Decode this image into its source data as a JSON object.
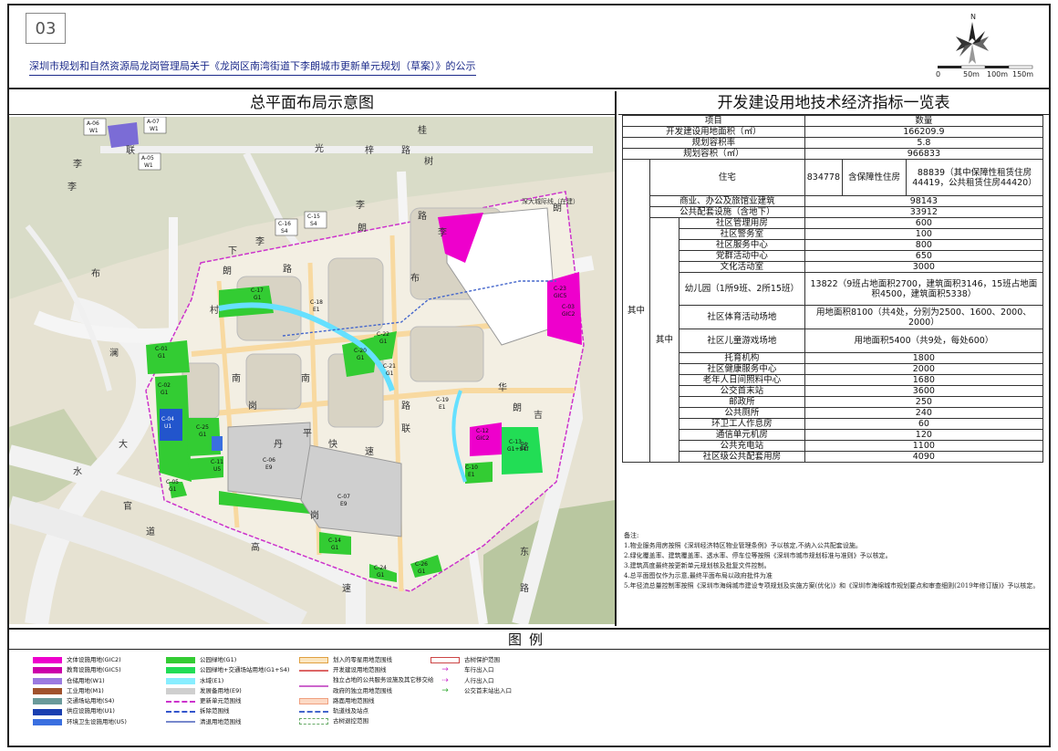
{
  "header": {
    "page_number": "03",
    "notice_title": "深圳市规划和自然资源局龙岗管理局关于《龙岗区南湾街道下李朗城市更新单元规划（草案）》的公示",
    "north_label": "N",
    "scale_labels": [
      "0",
      "50m",
      "100m",
      "150m"
    ]
  },
  "map_panel": {
    "title": "总平面布局示意图",
    "road_labels": [
      "桂",
      "光",
      "梓",
      "路",
      "树",
      "李",
      "朗",
      "深大城际线（在建）",
      "布",
      "澜",
      "大",
      "水",
      "官",
      "道",
      "高",
      "速",
      "南",
      "岗",
      "丹",
      "平",
      "快",
      "速",
      "路",
      "李",
      "朗",
      "路",
      "下",
      "李",
      "朗",
      "路",
      "李",
      "联",
      "李",
      "布",
      "村",
      "路",
      "联",
      "朗",
      "吉",
      "华",
      "南",
      "岗",
      "东",
      "路"
    ],
    "parcels": [
      {
        "code": "A-06",
        "use": "W1",
        "color": "#7b6cd6"
      },
      {
        "code": "A-07",
        "use": "W1",
        "color": "#7b6cd6"
      },
      {
        "code": "A-05",
        "use": "W1",
        "color": "#7b6cd6"
      },
      {
        "code": "C-16",
        "use": "S4",
        "color": "#cfcfcf"
      },
      {
        "code": "C-15",
        "use": "S4",
        "color": "#cfcfcf"
      },
      {
        "code": "C-17",
        "use": "G1",
        "color": "#33cc33"
      },
      {
        "code": "C-18",
        "use": "E1",
        "color": "#66e0ff"
      },
      {
        "code": "C-20",
        "use": "G1",
        "color": "#33cc33"
      },
      {
        "code": "C-22",
        "use": "G1",
        "color": "#33cc33"
      },
      {
        "code": "C-21",
        "use": "G1",
        "color": "#33cc33"
      },
      {
        "code": "C-01",
        "use": "G1",
        "color": "#33cc33"
      },
      {
        "code": "C-02",
        "use": "G1",
        "color": "#33cc33"
      },
      {
        "code": "C-04",
        "use": "U1",
        "color": "#2255cc"
      },
      {
        "code": "C-25",
        "use": "G1",
        "color": "#33cc33"
      },
      {
        "code": "C-11",
        "use": "U5",
        "color": "#2255cc"
      },
      {
        "code": "C-05",
        "use": "G1",
        "color": "#33cc33"
      },
      {
        "code": "C-06",
        "use": "E9",
        "color": "#cfcfcf"
      },
      {
        "code": "C-07",
        "use": "E9",
        "color": "#cfcfcf"
      },
      {
        "code": "C-14",
        "use": "G1",
        "color": "#33cc33"
      },
      {
        "code": "C-24",
        "use": "G1",
        "color": "#33cc33"
      },
      {
        "code": "C-26",
        "use": "G1",
        "color": "#33cc33"
      },
      {
        "code": "C-23",
        "use": "GIC5",
        "color": "#ee00cc"
      },
      {
        "code": "C-03",
        "use": "GIC2",
        "color": "#ee00cc"
      },
      {
        "code": "C-12",
        "use": "GIC2",
        "color": "#ee00cc"
      },
      {
        "code": "C-13",
        "use": "G1+S4",
        "color": "#33cc33"
      },
      {
        "code": "C-10",
        "use": "E1",
        "color": "#66e0ff"
      },
      {
        "code": "C-19",
        "use": "E1",
        "color": "#66e0ff"
      }
    ]
  },
  "indicator_table": {
    "title": "开发建设用地技术经济指标一览表",
    "head": {
      "item": "项目",
      "qty": "数量"
    },
    "rows_top": [
      {
        "item": "开发建设用地面积（㎡）",
        "qty": "166209.9"
      },
      {
        "item": "规划容积率",
        "qty": "5.8"
      },
      {
        "item": "规划容积（㎡）",
        "qty": "966833"
      }
    ],
    "residential": {
      "qi_zhong": "其中",
      "item": "住宅",
      "value": "834778",
      "sub_label": "含保障性住房",
      "sub_value": "88839（其中保障性租赁住房44419，公共租赁住房44420）"
    },
    "rows_mid": [
      {
        "item": "商业、办公及旅馆业建筑",
        "qty": "98143"
      },
      {
        "item": "公共配套设施（含地下）",
        "qty": "33912"
      }
    ],
    "sub_qi_zhong": "其中",
    "facilities": [
      {
        "item": "社区管理用房",
        "qty": "600"
      },
      {
        "item": "社区警务室",
        "qty": "100"
      },
      {
        "item": "社区服务中心",
        "qty": "800"
      },
      {
        "item": "党群活动中心",
        "qty": "650"
      },
      {
        "item": "文化活动室",
        "qty": "3000"
      },
      {
        "item": "幼儿园（1所9班、2所15班）",
        "qty": "13822（9班占地面积2700，建筑面积3146，15班占地面积4500，建筑面积5338）"
      },
      {
        "item": "社区体育活动场地",
        "qty": "用地面积8100（共4处，分别为2500、1600、2000、2000）"
      },
      {
        "item": "社区儿童游戏场地",
        "qty": "用地面积5400（共9处，每处600）"
      },
      {
        "item": "托育机构",
        "qty": "1800"
      },
      {
        "item": "社区健康服务中心",
        "qty": "2000"
      },
      {
        "item": "老年人日间照料中心",
        "qty": "1680"
      },
      {
        "item": "公交首末站",
        "qty": "3600"
      },
      {
        "item": "邮政所",
        "qty": "250"
      },
      {
        "item": "公共厕所",
        "qty": "240"
      },
      {
        "item": "环卫工人作息房",
        "qty": "60"
      },
      {
        "item": "通信单元机房",
        "qty": "120"
      },
      {
        "item": "公共充电站",
        "qty": "1100"
      },
      {
        "item": "社区级公共配套用房",
        "qty": "4090"
      }
    ]
  },
  "notes": {
    "heading": "备注:",
    "lines": [
      "1.物业服务用房按照《深圳经济特区物业管理条例》予以核定,不纳入公共配套设施。",
      "2.绿化覆盖率、建筑覆盖率、透水率、停车位等按照《深圳市城市规划标准与准则》予以核定。",
      "3.建筑高度最终按更新单元规划核及批复文件控制。",
      "4.总平面图仅作为示意,最终平面布局以政府批件为准",
      "5.年径流总量控制率按照《深圳市海绵城市建设专项规划及实施方案(优化)》和《深圳市海绵城市规划要点和审查细则(2019年修订版)》予以核定。"
    ]
  },
  "legend": {
    "title": "图例",
    "col1": [
      {
        "label": "文体设施用地(GIC2)",
        "color": "#ee00cc"
      },
      {
        "label": "教育设施用地(GIC5)",
        "color": "#cc00aa"
      },
      {
        "label": "仓储用地(W1)",
        "color": "#9b7ae0"
      },
      {
        "label": "工业用地(M1)",
        "color": "#a0522d"
      },
      {
        "label": "交通场站用地(S4)",
        "color": "#6a9a9a"
      },
      {
        "label": "供应设施用地(U1)",
        "color": "#1a3fb0"
      },
      {
        "label": "环境卫生设施用地(U5)",
        "color": "#3a6fe0"
      }
    ],
    "col2": [
      {
        "label": "公园绿地(G1)",
        "color": "#33cc33"
      },
      {
        "label": "公园绿地+交通场站用地(G1+S4)",
        "color": "#22dd55"
      },
      {
        "label": "水域(E1)",
        "color": "#88eeff"
      },
      {
        "label": "发展备用地(E9)",
        "color": "#cfcfcf"
      },
      {
        "label": "更新单元范围线",
        "color": "#cc33cc"
      },
      {
        "label": "拆除范围线",
        "color": "#3355cc"
      },
      {
        "label": "清退用地范围线",
        "color": "#7788cc"
      }
    ],
    "col3": [
      {
        "label": "划入的零星用地范围线",
        "color": "#e0a040"
      },
      {
        "label": "开发建设用地范围线",
        "color": "#dd6666"
      },
      {
        "label": "独立占地的公共服务设施及其它移交给政府的独立用地范围线",
        "color": "#cc66cc"
      },
      {
        "label": "路面用地范围线",
        "color": "#f0a080"
      },
      {
        "label": "轨道线及站点",
        "color": "#4466cc"
      },
      {
        "label": "古树退控范围",
        "color": "#66aa66"
      }
    ],
    "col4": [
      {
        "label": "古树保护范围",
        "color": "#cc4444"
      },
      {
        "label": "车行出入口",
        "color": "#cc33cc"
      },
      {
        "label": "人行出入口",
        "color": "#cc33cc"
      },
      {
        "label": "公交首末站出入口",
        "color": "#33aa33"
      }
    ]
  }
}
